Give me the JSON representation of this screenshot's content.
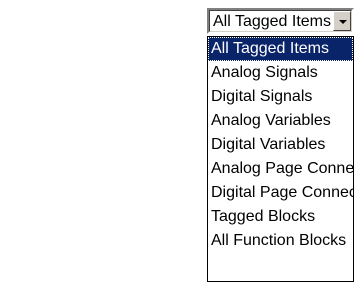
{
  "combo": {
    "value": "All Tagged Items",
    "button_icon": "chevron-down-icon"
  },
  "list": {
    "selected_index": 0,
    "options": [
      "All Tagged Items",
      "Analog Signals",
      "Digital Signals",
      "Analog Variables",
      "Digital Variables",
      "Analog Page Connectors",
      "Digital Page Connectors",
      "Tagged Blocks",
      "All Function Blocks"
    ]
  },
  "colors": {
    "selection_bg": "#0a246a",
    "selection_text": "#ffffff",
    "button_face": "#d4d0c8"
  }
}
